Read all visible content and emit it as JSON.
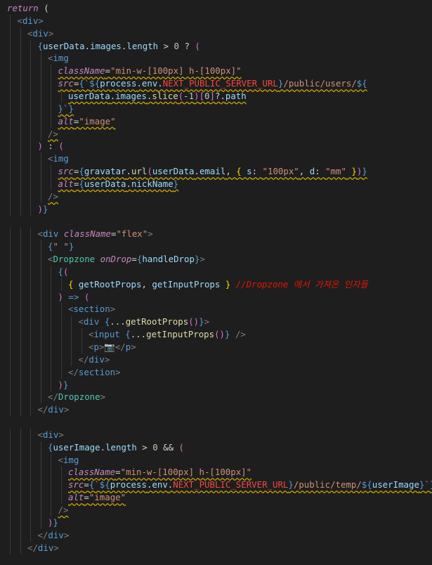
{
  "colors": {
    "background": "#1e1e1e",
    "indent_guide": "#3a3a3a",
    "warning_squiggle": "#cca700"
  },
  "lines": [
    {
      "indent": 0,
      "tokens": [
        {
          "t": "return",
          "c": "#c586c0",
          "i": true
        },
        {
          "t": " (",
          "c": "#d4d4d4"
        }
      ]
    },
    {
      "indent": 1,
      "tokens": [
        {
          "t": "<",
          "c": "#808080"
        },
        {
          "t": "div",
          "c": "#569cd6"
        },
        {
          "t": ">",
          "c": "#808080"
        }
      ]
    },
    {
      "indent": 2,
      "tokens": [
        {
          "t": "<",
          "c": "#808080"
        },
        {
          "t": "div",
          "c": "#569cd6"
        },
        {
          "t": ">",
          "c": "#808080"
        }
      ]
    },
    {
      "indent": 3,
      "tokens": [
        {
          "t": "{",
          "c": "#569cd6"
        },
        {
          "t": "userData",
          "c": "#9cdcfe"
        },
        {
          "t": ".",
          "c": "#d4d4d4"
        },
        {
          "t": "images",
          "c": "#9cdcfe"
        },
        {
          "t": ".",
          "c": "#d4d4d4"
        },
        {
          "t": "length",
          "c": "#9cdcfe"
        },
        {
          "t": " > ",
          "c": "#d4d4d4"
        },
        {
          "t": "0",
          "c": "#b5cea8"
        },
        {
          "t": " ? ",
          "c": "#d4d4d4"
        },
        {
          "t": "(",
          "c": "#da70d6"
        }
      ]
    },
    {
      "indent": 4,
      "tokens": [
        {
          "t": "<",
          "c": "#808080"
        },
        {
          "t": "img",
          "c": "#569cd6"
        }
      ]
    },
    {
      "indent": 5,
      "squiggle": true,
      "tokens": [
        {
          "t": "className",
          "c": "#c586c0",
          "i": true
        },
        {
          "t": "=",
          "c": "#d4d4d4"
        },
        {
          "t": "\"min-w-[100px] h-[100px]\"",
          "c": "#ce9178"
        }
      ]
    },
    {
      "indent": 5,
      "squiggle": true,
      "tokens": [
        {
          "t": "src",
          "c": "#c586c0",
          "i": true
        },
        {
          "t": "=",
          "c": "#d4d4d4"
        },
        {
          "t": "{",
          "c": "#569cd6"
        },
        {
          "t": "`",
          "c": "#ce9178"
        },
        {
          "t": "${",
          "c": "#569cd6"
        },
        {
          "t": "process",
          "c": "#9cdcfe"
        },
        {
          "t": ".",
          "c": "#d4d4d4"
        },
        {
          "t": "env",
          "c": "#9cdcfe"
        },
        {
          "t": ".",
          "c": "#d4d4d4"
        },
        {
          "t": "NEXT_PUBLIC_SERVER_URL",
          "c": "#f44747"
        },
        {
          "t": "}",
          "c": "#569cd6"
        },
        {
          "t": "/public/users/",
          "c": "#ce9178"
        },
        {
          "t": "${",
          "c": "#569cd6"
        }
      ]
    },
    {
      "indent": 6,
      "squiggle": true,
      "tokens": [
        {
          "t": "userData",
          "c": "#9cdcfe"
        },
        {
          "t": ".",
          "c": "#d4d4d4"
        },
        {
          "t": "images",
          "c": "#9cdcfe"
        },
        {
          "t": ".",
          "c": "#d4d4d4"
        },
        {
          "t": "slice",
          "c": "#dcdcaa"
        },
        {
          "t": "(",
          "c": "#da70d6"
        },
        {
          "t": "-1",
          "c": "#b5cea8"
        },
        {
          "t": ")",
          "c": "#da70d6"
        },
        {
          "t": "[",
          "c": "#da70d6"
        },
        {
          "t": "0",
          "c": "#b5cea8"
        },
        {
          "t": "]",
          "c": "#da70d6"
        },
        {
          "t": "?.",
          "c": "#d4d4d4"
        },
        {
          "t": "path",
          "c": "#9cdcfe"
        }
      ]
    },
    {
      "indent": 5,
      "squiggle": true,
      "tokens": [
        {
          "t": "}",
          "c": "#569cd6"
        },
        {
          "t": "`",
          "c": "#ce9178"
        },
        {
          "t": "}",
          "c": "#569cd6"
        }
      ]
    },
    {
      "indent": 5,
      "squiggle": true,
      "tokens": [
        {
          "t": "alt",
          "c": "#c586c0",
          "i": true
        },
        {
          "t": "=",
          "c": "#d4d4d4"
        },
        {
          "t": "\"image\"",
          "c": "#ce9178"
        }
      ]
    },
    {
      "indent": 4,
      "squiggle": true,
      "tokens": [
        {
          "t": "/>",
          "c": "#808080"
        }
      ]
    },
    {
      "indent": 3,
      "tokens": [
        {
          "t": ")",
          "c": "#da70d6"
        },
        {
          "t": " : ",
          "c": "#d4d4d4"
        },
        {
          "t": "(",
          "c": "#da70d6"
        }
      ]
    },
    {
      "indent": 4,
      "tokens": [
        {
          "t": "<",
          "c": "#808080"
        },
        {
          "t": "img",
          "c": "#569cd6"
        }
      ]
    },
    {
      "indent": 5,
      "squiggle": true,
      "tokens": [
        {
          "t": "src",
          "c": "#c586c0",
          "i": true
        },
        {
          "t": "=",
          "c": "#d4d4d4"
        },
        {
          "t": "{",
          "c": "#569cd6"
        },
        {
          "t": "gravatar",
          "c": "#9cdcfe"
        },
        {
          "t": ".",
          "c": "#d4d4d4"
        },
        {
          "t": "url",
          "c": "#dcdcaa"
        },
        {
          "t": "(",
          "c": "#da70d6"
        },
        {
          "t": "userData",
          "c": "#9cdcfe"
        },
        {
          "t": ".",
          "c": "#d4d4d4"
        },
        {
          "t": "email",
          "c": "#9cdcfe"
        },
        {
          "t": ", ",
          "c": "#d4d4d4"
        },
        {
          "t": "{",
          "c": "#ffd700"
        },
        {
          "t": " s",
          "c": "#9cdcfe"
        },
        {
          "t": ": ",
          "c": "#d4d4d4"
        },
        {
          "t": "\"100px\"",
          "c": "#ce9178"
        },
        {
          "t": ", ",
          "c": "#d4d4d4"
        },
        {
          "t": "d",
          "c": "#9cdcfe"
        },
        {
          "t": ": ",
          "c": "#d4d4d4"
        },
        {
          "t": "\"mm\"",
          "c": "#ce9178"
        },
        {
          "t": " }",
          "c": "#ffd700"
        },
        {
          "t": ")",
          "c": "#da70d6"
        },
        {
          "t": "}",
          "c": "#569cd6"
        }
      ]
    },
    {
      "indent": 5,
      "squiggle": true,
      "tokens": [
        {
          "t": "alt",
          "c": "#c586c0",
          "i": true
        },
        {
          "t": "=",
          "c": "#d4d4d4"
        },
        {
          "t": "{",
          "c": "#569cd6"
        },
        {
          "t": "userData",
          "c": "#9cdcfe"
        },
        {
          "t": ".",
          "c": "#d4d4d4"
        },
        {
          "t": "nickName",
          "c": "#9cdcfe"
        },
        {
          "t": "}",
          "c": "#569cd6"
        }
      ]
    },
    {
      "indent": 4,
      "squiggle": true,
      "tokens": [
        {
          "t": "/>",
          "c": "#808080"
        }
      ]
    },
    {
      "indent": 3,
      "tokens": [
        {
          "t": ")",
          "c": "#da70d6"
        },
        {
          "t": "}",
          "c": "#569cd6"
        }
      ]
    },
    {
      "indent": 0,
      "tokens": []
    },
    {
      "indent": 3,
      "tokens": [
        {
          "t": "<",
          "c": "#808080"
        },
        {
          "t": "div",
          "c": "#569cd6"
        },
        {
          "t": " ",
          "c": "#d4d4d4"
        },
        {
          "t": "className",
          "c": "#c586c0",
          "i": true
        },
        {
          "t": "=",
          "c": "#d4d4d4"
        },
        {
          "t": "\"flex\"",
          "c": "#ce9178"
        },
        {
          "t": ">",
          "c": "#808080"
        }
      ]
    },
    {
      "indent": 4,
      "tokens": [
        {
          "t": "{",
          "c": "#569cd6"
        },
        {
          "t": "\" \"",
          "c": "#ce9178"
        },
        {
          "t": "}",
          "c": "#569cd6"
        }
      ]
    },
    {
      "indent": 4,
      "tokens": [
        {
          "t": "<",
          "c": "#808080"
        },
        {
          "t": "Dropzone",
          "c": "#4ec9b0"
        },
        {
          "t": " ",
          "c": "#d4d4d4"
        },
        {
          "t": "onDrop",
          "c": "#c586c0",
          "i": true
        },
        {
          "t": "=",
          "c": "#d4d4d4"
        },
        {
          "t": "{",
          "c": "#569cd6"
        },
        {
          "t": "handleDrop",
          "c": "#9cdcfe"
        },
        {
          "t": "}",
          "c": "#569cd6"
        },
        {
          "t": ">",
          "c": "#808080"
        }
      ]
    },
    {
      "indent": 5,
      "tokens": [
        {
          "t": "{",
          "c": "#569cd6"
        },
        {
          "t": "(",
          "c": "#da70d6"
        }
      ]
    },
    {
      "indent": 6,
      "tokens": [
        {
          "t": "{",
          "c": "#ffd700"
        },
        {
          "t": " getRootProps",
          "c": "#9cdcfe"
        },
        {
          "t": ", ",
          "c": "#d4d4d4"
        },
        {
          "t": "getInputProps",
          "c": "#9cdcfe"
        },
        {
          "t": " }",
          "c": "#ffd700"
        },
        {
          "t": " //Dropzone 에서 가져온 인자들",
          "c": "#e51400",
          "i": true
        }
      ]
    },
    {
      "indent": 5,
      "tokens": [
        {
          "t": ")",
          "c": "#da70d6"
        },
        {
          "t": " => ",
          "c": "#569cd6"
        },
        {
          "t": "(",
          "c": "#da70d6"
        }
      ]
    },
    {
      "indent": 6,
      "tokens": [
        {
          "t": "<",
          "c": "#808080"
        },
        {
          "t": "section",
          "c": "#569cd6"
        },
        {
          "t": ">",
          "c": "#808080"
        }
      ]
    },
    {
      "indent": 7,
      "tokens": [
        {
          "t": "<",
          "c": "#808080"
        },
        {
          "t": "div",
          "c": "#569cd6"
        },
        {
          "t": " ",
          "c": "#d4d4d4"
        },
        {
          "t": "{",
          "c": "#569cd6"
        },
        {
          "t": "...",
          "c": "#d4d4d4"
        },
        {
          "t": "getRootProps",
          "c": "#dcdcaa"
        },
        {
          "t": "()",
          "c": "#da70d6"
        },
        {
          "t": "}",
          "c": "#569cd6"
        },
        {
          "t": ">",
          "c": "#808080"
        }
      ]
    },
    {
      "indent": 8,
      "tokens": [
        {
          "t": "<",
          "c": "#808080"
        },
        {
          "t": "input",
          "c": "#569cd6"
        },
        {
          "t": " ",
          "c": "#d4d4d4"
        },
        {
          "t": "{",
          "c": "#569cd6"
        },
        {
          "t": "...",
          "c": "#d4d4d4"
        },
        {
          "t": "getInputProps",
          "c": "#dcdcaa"
        },
        {
          "t": "()",
          "c": "#da70d6"
        },
        {
          "t": "}",
          "c": "#569cd6"
        },
        {
          "t": " />",
          "c": "#808080"
        }
      ]
    },
    {
      "indent": 8,
      "tokens": [
        {
          "t": "<",
          "c": "#808080"
        },
        {
          "t": "p",
          "c": "#569cd6"
        },
        {
          "t": ">",
          "c": "#808080"
        },
        {
          "t": "📷",
          "c": "#d4d4d4"
        },
        {
          "t": "</",
          "c": "#808080"
        },
        {
          "t": "p",
          "c": "#569cd6"
        },
        {
          "t": ">",
          "c": "#808080"
        }
      ]
    },
    {
      "indent": 7,
      "tokens": [
        {
          "t": "</",
          "c": "#808080"
        },
        {
          "t": "div",
          "c": "#569cd6"
        },
        {
          "t": ">",
          "c": "#808080"
        }
      ]
    },
    {
      "indent": 6,
      "tokens": [
        {
          "t": "</",
          "c": "#808080"
        },
        {
          "t": "section",
          "c": "#569cd6"
        },
        {
          "t": ">",
          "c": "#808080"
        }
      ]
    },
    {
      "indent": 5,
      "tokens": [
        {
          "t": ")",
          "c": "#da70d6"
        },
        {
          "t": "}",
          "c": "#569cd6"
        }
      ]
    },
    {
      "indent": 4,
      "tokens": [
        {
          "t": "</",
          "c": "#808080"
        },
        {
          "t": "Dropzone",
          "c": "#4ec9b0"
        },
        {
          "t": ">",
          "c": "#808080"
        }
      ]
    },
    {
      "indent": 3,
      "tokens": [
        {
          "t": "</",
          "c": "#808080"
        },
        {
          "t": "div",
          "c": "#569cd6"
        },
        {
          "t": ">",
          "c": "#808080"
        }
      ]
    },
    {
      "indent": 0,
      "tokens": []
    },
    {
      "indent": 3,
      "tokens": [
        {
          "t": "<",
          "c": "#808080"
        },
        {
          "t": "div",
          "c": "#569cd6"
        },
        {
          "t": ">",
          "c": "#808080"
        }
      ]
    },
    {
      "indent": 4,
      "tokens": [
        {
          "t": "{",
          "c": "#569cd6"
        },
        {
          "t": "userImage",
          "c": "#9cdcfe"
        },
        {
          "t": ".",
          "c": "#d4d4d4"
        },
        {
          "t": "length",
          "c": "#9cdcfe"
        },
        {
          "t": " > ",
          "c": "#d4d4d4"
        },
        {
          "t": "0",
          "c": "#b5cea8"
        },
        {
          "t": " && ",
          "c": "#d4d4d4"
        },
        {
          "t": "(",
          "c": "#da70d6"
        }
      ]
    },
    {
      "indent": 5,
      "tokens": [
        {
          "t": "<",
          "c": "#808080"
        },
        {
          "t": "img",
          "c": "#569cd6"
        }
      ]
    },
    {
      "indent": 6,
      "squiggle": true,
      "tokens": [
        {
          "t": "className",
          "c": "#c586c0",
          "i": true
        },
        {
          "t": "=",
          "c": "#d4d4d4"
        },
        {
          "t": "\"min-w-[100px] h-[100px]\"",
          "c": "#ce9178"
        }
      ]
    },
    {
      "indent": 6,
      "squiggle": true,
      "tokens": [
        {
          "t": "src",
          "c": "#c586c0",
          "i": true
        },
        {
          "t": "=",
          "c": "#d4d4d4"
        },
        {
          "t": "{",
          "c": "#569cd6"
        },
        {
          "t": "`",
          "c": "#ce9178"
        },
        {
          "t": "${",
          "c": "#569cd6"
        },
        {
          "t": "process",
          "c": "#9cdcfe"
        },
        {
          "t": ".",
          "c": "#d4d4d4"
        },
        {
          "t": "env",
          "c": "#9cdcfe"
        },
        {
          "t": ".",
          "c": "#d4d4d4"
        },
        {
          "t": "NEXT_PUBLIC_SERVER_URL",
          "c": "#f44747"
        },
        {
          "t": "}",
          "c": "#569cd6"
        },
        {
          "t": "/public/temp/",
          "c": "#ce9178"
        },
        {
          "t": "${",
          "c": "#569cd6"
        },
        {
          "t": "userImage",
          "c": "#9cdcfe"
        },
        {
          "t": "}",
          "c": "#569cd6"
        },
        {
          "t": "`",
          "c": "#ce9178"
        },
        {
          "t": "}",
          "c": "#569cd6"
        }
      ]
    },
    {
      "indent": 6,
      "squiggle": true,
      "tokens": [
        {
          "t": "alt",
          "c": "#c586c0",
          "i": true
        },
        {
          "t": "=",
          "c": "#d4d4d4"
        },
        {
          "t": "\"image\"",
          "c": "#ce9178"
        }
      ]
    },
    {
      "indent": 5,
      "squiggle": true,
      "tokens": [
        {
          "t": "/>",
          "c": "#808080"
        }
      ]
    },
    {
      "indent": 4,
      "tokens": [
        {
          "t": ")",
          "c": "#da70d6"
        },
        {
          "t": "}",
          "c": "#569cd6"
        }
      ]
    },
    {
      "indent": 3,
      "tokens": [
        {
          "t": "</",
          "c": "#808080"
        },
        {
          "t": "div",
          "c": "#569cd6"
        },
        {
          "t": ">",
          "c": "#808080"
        }
      ]
    },
    {
      "indent": 2,
      "tokens": [
        {
          "t": "</",
          "c": "#808080"
        },
        {
          "t": "div",
          "c": "#569cd6"
        },
        {
          "t": ">",
          "c": "#808080"
        }
      ]
    }
  ]
}
